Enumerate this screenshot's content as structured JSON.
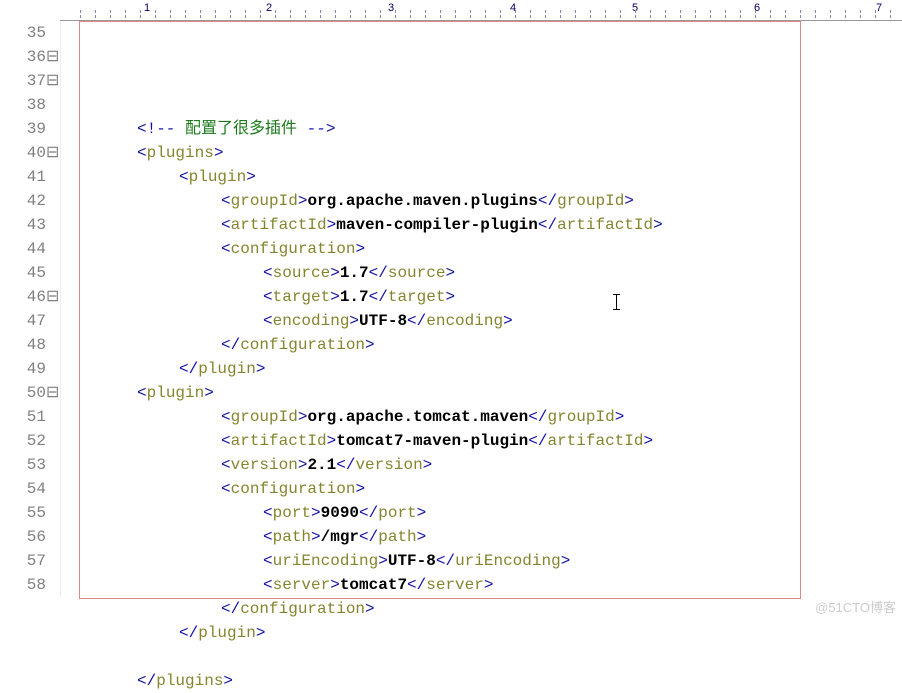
{
  "ruler": {
    "numbers": [
      "1",
      "2",
      "3",
      "4",
      "5",
      "6",
      "7"
    ]
  },
  "lines": [
    {
      "num": "35",
      "fold": "",
      "indent": "i2",
      "tokens": [
        {
          "cls": "c-tag",
          "t": "<!--"
        },
        {
          "cls": "c-comment",
          "t": " 配置了很多插件 "
        },
        {
          "cls": "c-tag",
          "t": "-->"
        }
      ]
    },
    {
      "num": "36",
      "fold": "⊟",
      "indent": "i2",
      "tokens": [
        {
          "cls": "c-tag",
          "t": "<"
        },
        {
          "cls": "c-attr",
          "t": "plugins"
        },
        {
          "cls": "c-tag",
          "t": ">"
        }
      ]
    },
    {
      "num": "37",
      "fold": "⊟",
      "indent": "i3",
      "tokens": [
        {
          "cls": "c-tag",
          "t": "<"
        },
        {
          "cls": "c-attr",
          "t": "plugin"
        },
        {
          "cls": "c-tag",
          "t": ">"
        }
      ]
    },
    {
      "num": "38",
      "fold": "",
      "indent": "i4",
      "tokens": [
        {
          "cls": "c-tag",
          "t": "<"
        },
        {
          "cls": "c-attr",
          "t": "groupId"
        },
        {
          "cls": "c-tag",
          "t": ">"
        },
        {
          "cls": "c-text",
          "t": "org.apache.maven.plugins"
        },
        {
          "cls": "c-tag",
          "t": "</"
        },
        {
          "cls": "c-attr",
          "t": "groupId"
        },
        {
          "cls": "c-tag",
          "t": ">"
        }
      ]
    },
    {
      "num": "39",
      "fold": "",
      "indent": "i4",
      "tokens": [
        {
          "cls": "c-tag",
          "t": "<"
        },
        {
          "cls": "c-attr",
          "t": "artifactId"
        },
        {
          "cls": "c-tag",
          "t": ">"
        },
        {
          "cls": "c-text",
          "t": "maven-compiler-plugin"
        },
        {
          "cls": "c-tag",
          "t": "</"
        },
        {
          "cls": "c-attr",
          "t": "artifactId"
        },
        {
          "cls": "c-tag",
          "t": ">"
        }
      ]
    },
    {
      "num": "40",
      "fold": "⊟",
      "indent": "i4",
      "tokens": [
        {
          "cls": "c-tag",
          "t": "<"
        },
        {
          "cls": "c-attr",
          "t": "configuration"
        },
        {
          "cls": "c-tag",
          "t": ">"
        }
      ]
    },
    {
      "num": "41",
      "fold": "",
      "indent": "i5",
      "tokens": [
        {
          "cls": "c-tag",
          "t": "<"
        },
        {
          "cls": "c-attr",
          "t": "source"
        },
        {
          "cls": "c-tag",
          "t": ">"
        },
        {
          "cls": "c-text",
          "t": "1.7"
        },
        {
          "cls": "c-tag",
          "t": "</"
        },
        {
          "cls": "c-attr",
          "t": "source"
        },
        {
          "cls": "c-tag",
          "t": ">"
        }
      ]
    },
    {
      "num": "42",
      "fold": "",
      "indent": "i5",
      "tokens": [
        {
          "cls": "c-tag",
          "t": "<"
        },
        {
          "cls": "c-attr",
          "t": "target"
        },
        {
          "cls": "c-tag",
          "t": ">"
        },
        {
          "cls": "c-text",
          "t": "1.7"
        },
        {
          "cls": "c-tag",
          "t": "</"
        },
        {
          "cls": "c-attr",
          "t": "target"
        },
        {
          "cls": "c-tag",
          "t": ">"
        }
      ]
    },
    {
      "num": "43",
      "fold": "",
      "indent": "i5",
      "tokens": [
        {
          "cls": "c-tag",
          "t": "<"
        },
        {
          "cls": "c-attr",
          "t": "encoding"
        },
        {
          "cls": "c-tag",
          "t": ">"
        },
        {
          "cls": "c-text",
          "t": "UTF-8"
        },
        {
          "cls": "c-tag",
          "t": "</"
        },
        {
          "cls": "c-attr",
          "t": "encoding"
        },
        {
          "cls": "c-tag",
          "t": ">"
        }
      ]
    },
    {
      "num": "44",
      "fold": "",
      "indent": "i4",
      "tokens": [
        {
          "cls": "c-tag",
          "t": "</"
        },
        {
          "cls": "c-attr",
          "t": "configuration"
        },
        {
          "cls": "c-tag",
          "t": ">"
        }
      ]
    },
    {
      "num": "45",
      "fold": "",
      "indent": "i3",
      "tokens": [
        {
          "cls": "c-tag",
          "t": "</"
        },
        {
          "cls": "c-attr",
          "t": "plugin"
        },
        {
          "cls": "c-tag",
          "t": ">"
        }
      ]
    },
    {
      "num": "46",
      "fold": "⊟",
      "indent": "i2",
      "tokens": [
        {
          "cls": "c-tag",
          "t": "<"
        },
        {
          "cls": "c-attr",
          "t": "plugin"
        },
        {
          "cls": "c-tag",
          "t": ">"
        }
      ]
    },
    {
      "num": "47",
      "fold": "",
      "indent": "i4",
      "tokens": [
        {
          "cls": "c-tag",
          "t": "<"
        },
        {
          "cls": "c-attr",
          "t": "groupId"
        },
        {
          "cls": "c-tag",
          "t": ">"
        },
        {
          "cls": "c-text",
          "t": "org.apache.tomcat.maven"
        },
        {
          "cls": "c-tag",
          "t": "</"
        },
        {
          "cls": "c-attr",
          "t": "groupId"
        },
        {
          "cls": "c-tag",
          "t": ">"
        }
      ]
    },
    {
      "num": "48",
      "fold": "",
      "indent": "i4",
      "tokens": [
        {
          "cls": "c-tag",
          "t": "<"
        },
        {
          "cls": "c-attr",
          "t": "artifactId"
        },
        {
          "cls": "c-tag",
          "t": ">"
        },
        {
          "cls": "c-text",
          "t": "tomcat7-maven-plugin"
        },
        {
          "cls": "c-tag",
          "t": "</"
        },
        {
          "cls": "c-attr",
          "t": "artifactId"
        },
        {
          "cls": "c-tag",
          "t": ">"
        }
      ]
    },
    {
      "num": "49",
      "fold": "",
      "indent": "i4",
      "tokens": [
        {
          "cls": "c-tag",
          "t": "<"
        },
        {
          "cls": "c-attr",
          "t": "version"
        },
        {
          "cls": "c-tag",
          "t": ">"
        },
        {
          "cls": "c-text",
          "t": "2.1"
        },
        {
          "cls": "c-tag",
          "t": "</"
        },
        {
          "cls": "c-attr",
          "t": "version"
        },
        {
          "cls": "c-tag",
          "t": ">"
        }
      ]
    },
    {
      "num": "50",
      "fold": "⊟",
      "indent": "i4",
      "tokens": [
        {
          "cls": "c-tag",
          "t": "<"
        },
        {
          "cls": "c-attr",
          "t": "configuration"
        },
        {
          "cls": "c-tag",
          "t": ">"
        }
      ]
    },
    {
      "num": "51",
      "fold": "",
      "indent": "i5",
      "tokens": [
        {
          "cls": "c-tag",
          "t": "<"
        },
        {
          "cls": "c-attr",
          "t": "port"
        },
        {
          "cls": "c-tag",
          "t": ">"
        },
        {
          "cls": "c-text",
          "t": "9090"
        },
        {
          "cls": "c-tag",
          "t": "</"
        },
        {
          "cls": "c-attr",
          "t": "port"
        },
        {
          "cls": "c-tag",
          "t": ">"
        }
      ]
    },
    {
      "num": "52",
      "fold": "",
      "indent": "i5",
      "tokens": [
        {
          "cls": "c-tag",
          "t": "<"
        },
        {
          "cls": "c-attr",
          "t": "path"
        },
        {
          "cls": "c-tag",
          "t": ">"
        },
        {
          "cls": "c-text",
          "t": "/mgr"
        },
        {
          "cls": "c-tag",
          "t": "</"
        },
        {
          "cls": "c-attr",
          "t": "path"
        },
        {
          "cls": "c-tag",
          "t": ">"
        }
      ]
    },
    {
      "num": "53",
      "fold": "",
      "indent": "i5",
      "tokens": [
        {
          "cls": "c-tag",
          "t": "<"
        },
        {
          "cls": "c-attr",
          "t": "uriEncoding"
        },
        {
          "cls": "c-tag",
          "t": ">"
        },
        {
          "cls": "c-text",
          "t": "UTF-8"
        },
        {
          "cls": "c-tag",
          "t": "</"
        },
        {
          "cls": "c-attr",
          "t": "uriEncoding"
        },
        {
          "cls": "c-tag",
          "t": ">"
        }
      ]
    },
    {
      "num": "54",
      "fold": "",
      "indent": "i5",
      "tokens": [
        {
          "cls": "c-tag",
          "t": "<"
        },
        {
          "cls": "c-attr",
          "t": "server"
        },
        {
          "cls": "c-tag",
          "t": ">"
        },
        {
          "cls": "c-text",
          "t": "tomcat7"
        },
        {
          "cls": "c-tag",
          "t": "</"
        },
        {
          "cls": "c-attr",
          "t": "server"
        },
        {
          "cls": "c-tag",
          "t": ">"
        }
      ]
    },
    {
      "num": "55",
      "fold": "",
      "indent": "i4",
      "tokens": [
        {
          "cls": "c-tag",
          "t": "</"
        },
        {
          "cls": "c-attr",
          "t": "configuration"
        },
        {
          "cls": "c-tag",
          "t": ">"
        }
      ]
    },
    {
      "num": "56",
      "fold": "",
      "indent": "i3",
      "tokens": [
        {
          "cls": "c-tag",
          "t": "</"
        },
        {
          "cls": "c-attr",
          "t": "plugin"
        },
        {
          "cls": "c-tag",
          "t": ">"
        }
      ]
    },
    {
      "num": "57",
      "fold": "",
      "indent": "i2",
      "tokens": []
    },
    {
      "num": "58",
      "fold": "",
      "indent": "i2",
      "tokens": [
        {
          "cls": "c-tag",
          "t": "</"
        },
        {
          "cls": "c-attr",
          "t": "plugins"
        },
        {
          "cls": "c-tag",
          "t": ">"
        }
      ]
    }
  ],
  "watermark": "@51CTO博客"
}
